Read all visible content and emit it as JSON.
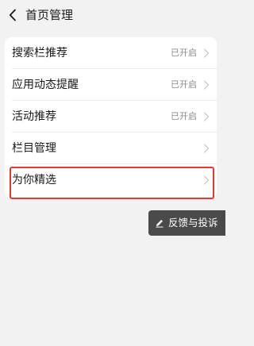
{
  "header": {
    "title": "首页管理",
    "back_icon": "chevron-left-icon"
  },
  "settings": {
    "items": [
      {
        "label": "搜索栏推荐",
        "status": "已开启"
      },
      {
        "label": "应用动态提醒",
        "status": "已开启"
      },
      {
        "label": "活动推荐",
        "status": "已开启"
      },
      {
        "label": "栏目管理",
        "status": ""
      },
      {
        "label": "为你精选",
        "status": ""
      }
    ]
  },
  "feedback": {
    "label": "反馈与投诉",
    "icon": "pencil-icon"
  },
  "colors": {
    "background": "#f2f2f2",
    "card": "#ffffff",
    "highlight": "#e53935",
    "feedback_bg": "#4a4a4a",
    "secondary_text": "#8c8c8c"
  }
}
